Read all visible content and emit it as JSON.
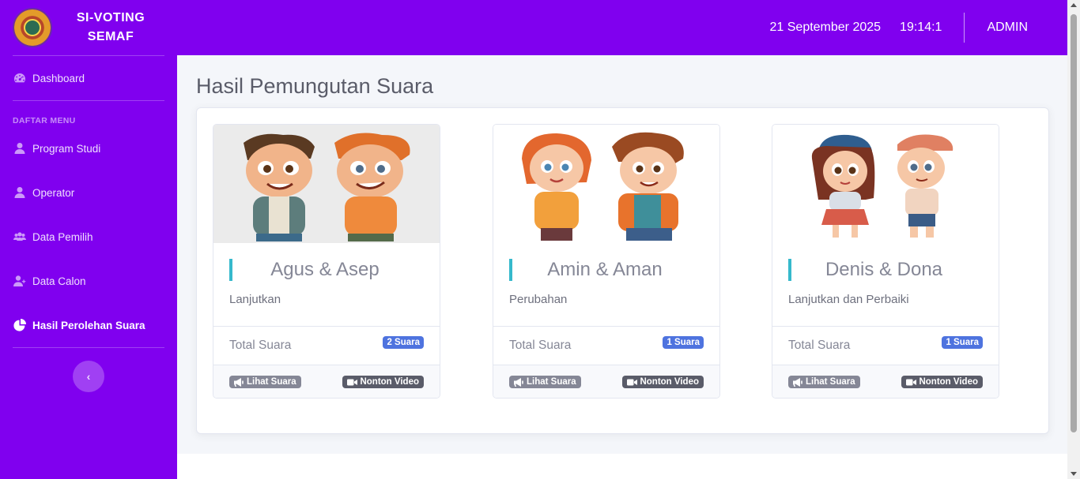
{
  "app": {
    "title_line1": "SI-VOTING",
    "title_line2": "SEMAF"
  },
  "colors": {
    "sidebar": "#8000ef",
    "accent": "#36b9cc",
    "primary_badge": "#4e73df",
    "secondary_badge": "#858796",
    "dark_badge": "#5a5c69"
  },
  "sidebar": {
    "dashboard": "Dashboard",
    "section_heading": "DAFTAR MENU",
    "items": [
      {
        "label": "Program Studi",
        "icon": "user-icon"
      },
      {
        "label": "Operator",
        "icon": "user-icon"
      },
      {
        "label": "Data Pemilih",
        "icon": "users-icon"
      },
      {
        "label": "Data Calon",
        "icon": "user-plus-icon"
      },
      {
        "label": "Hasil Perolehan Suara",
        "icon": "chart-pie-icon",
        "active": true
      }
    ]
  },
  "topbar": {
    "date": "21 September 2025",
    "time": "19:14:1",
    "user": "ADMIN"
  },
  "page": {
    "title": "Hasil Pemungutan Suara"
  },
  "candidates": [
    {
      "name": "Agus & Asep",
      "motto": "Lanjutkan",
      "total_label": "Total Suara",
      "votes": "2 Suara",
      "view_label": "Lihat Suara",
      "video_label": "Nonton Video"
    },
    {
      "name": "Amin & Aman",
      "motto": "Perubahan",
      "total_label": "Total Suara",
      "votes": "1 Suara",
      "view_label": "Lihat Suara",
      "video_label": "Nonton Video"
    },
    {
      "name": "Denis & Dona",
      "motto": "Lanjutkan dan Perbaiki",
      "total_label": "Total Suara",
      "votes": "1 Suara",
      "view_label": "Lihat Suara",
      "video_label": "Nonton Video"
    }
  ]
}
